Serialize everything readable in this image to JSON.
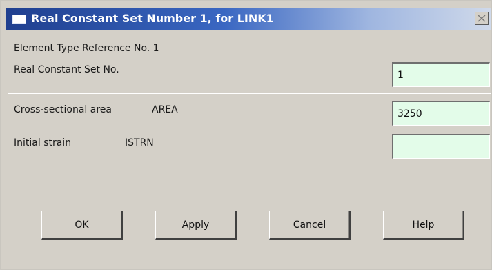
{
  "window": {
    "title": "Real Constant Set Number 1, for LINK1"
  },
  "form": {
    "element_type_ref": "Element Type Reference No. 1",
    "real_constant_set_label": "Real Constant Set No.",
    "real_constant_set_value": "1",
    "area_label": "Cross-sectional area",
    "area_key": "AREA",
    "area_value": "3250",
    "strain_label": "Initial strain",
    "strain_key": "ISTRN",
    "strain_value": ""
  },
  "buttons": {
    "ok": "OK",
    "apply": "Apply",
    "cancel": "Cancel",
    "help": "Help"
  },
  "colors": {
    "field_background": "#e3fce9",
    "title_gradient_start": "#1f3f8f",
    "dialog_background": "#d4d0c8"
  },
  "icons": {
    "window_icon": "window-icon",
    "close": "close-icon"
  }
}
